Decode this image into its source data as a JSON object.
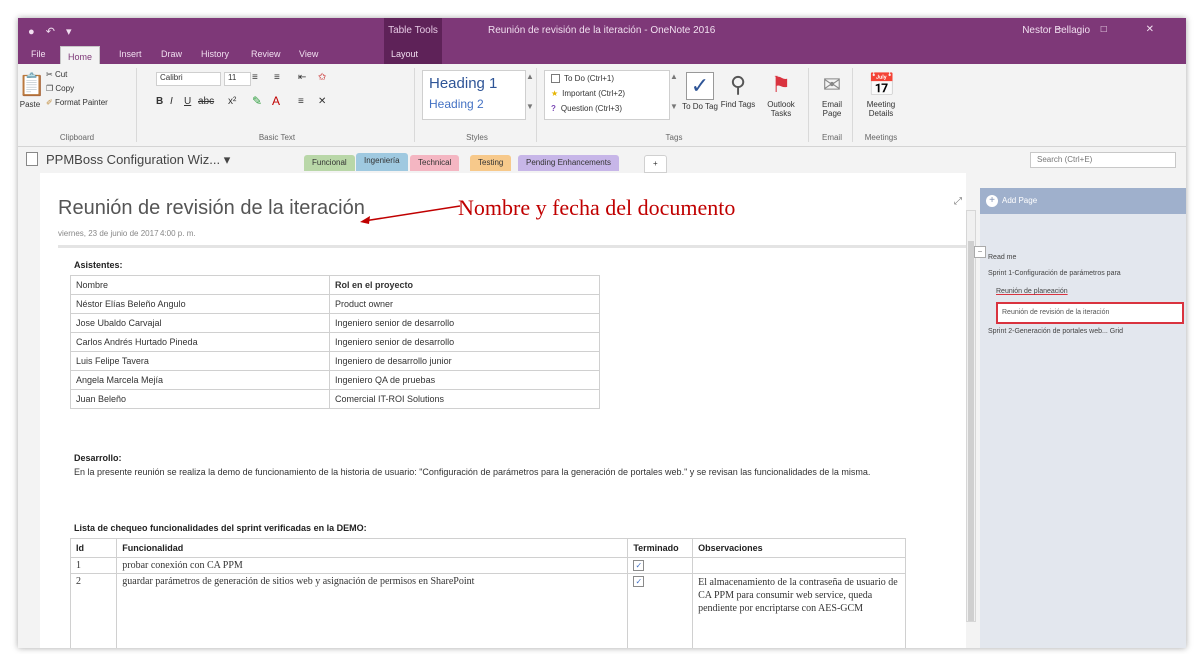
{
  "titlebar": {
    "quick_access": "● ↶ ▾",
    "contextual_tab": "Table Tools",
    "document_title": "Reunión de revisión de la iteración - OneNote 2016",
    "user": "Nestor Bellagio",
    "window_buttons": "− □ ✕"
  },
  "ribbon_tabs": [
    "File",
    "Home",
    "Insert",
    "Draw",
    "History",
    "Review",
    "View",
    "Layout"
  ],
  "ribbon": {
    "clipboard": {
      "paste": "Paste",
      "cut": "Cut",
      "copy": "Copy",
      "format_painter": "Format Painter",
      "label": "Clipboard"
    },
    "basic_text": {
      "font": "Calibri",
      "size": "11",
      "label": "Basic Text"
    },
    "styles": {
      "heading1": "Heading 1",
      "heading2": "Heading 2",
      "label": "Styles"
    },
    "tags": {
      "todo": "To Do (Ctrl+1)",
      "important": "Important (Ctrl+2)",
      "question": "Question (Ctrl+3)",
      "todo_tag": "To Do Tag",
      "find_tags": "Find Tags",
      "outlook_tasks": "Outlook Tasks",
      "label": "Tags"
    },
    "email": {
      "email_page": "Email Page",
      "label": "Email"
    },
    "meetings": {
      "meeting_details": "Meeting Details",
      "label": "Meetings"
    }
  },
  "notebook": {
    "name": "PPMBoss Configuration Wiz...",
    "dropdown": "▾",
    "sections": [
      {
        "label": "Funcional",
        "color": "#b9d7a8"
      },
      {
        "label": "Ingeniería",
        "color": "#9fc9e0"
      },
      {
        "label": "Technical",
        "color": "#f4b6c2"
      },
      {
        "label": "Testing",
        "color": "#f7c98b"
      },
      {
        "label": "Pending Enhancements",
        "color": "#c7b6e8"
      }
    ],
    "add_section": "+",
    "search_placeholder": "Search (Ctrl+E)"
  },
  "page": {
    "title": "Reunión de revisión de la iteración",
    "annotation": "Nombre y fecha del documento",
    "date": "viernes, 23 de junio de 2017",
    "time": "4:00 p. m.",
    "attendees_label": "Asistentes:",
    "attendees_headers": [
      "Nombre",
      "Rol en el proyecto"
    ],
    "attendees": [
      [
        "Néstor Elías Beleño Angulo",
        "Product owner"
      ],
      [
        "Jose Ubaldo Carvajal",
        "Ingeniero senior de desarrollo"
      ],
      [
        "Carlos Andrés Hurtado Pineda",
        "Ingeniero senior de desarrollo"
      ],
      [
        "Luis Felipe Tavera",
        "Ingeniero de desarrollo junior"
      ],
      [
        "Angela Marcela Mejía",
        "Ingeniero QA de pruebas"
      ],
      [
        "Juan Beleño",
        "Comercial IT-ROI Solutions"
      ]
    ],
    "development_label": "Desarrollo:",
    "development_text": "En la presente reunión se realiza la demo de funcionamiento de la historia de usuario: \"Configuración de parámetros para la generación de portales web.\" y se revisan las funcionalidades de la misma.",
    "checklist_label": "Lista de chequeo funcionalidades del sprint verificadas en la DEMO:",
    "checklist_headers": [
      "Id",
      "Funcionalidad",
      "Terminado",
      "Observaciones"
    ],
    "checklist": [
      {
        "id": "1",
        "func": "probar conexión con CA PPM",
        "done": "✓",
        "obs": ""
      },
      {
        "id": "2",
        "func": "guardar parámetros de generación de sitios web y asignación de permisos en SharePoint",
        "done": "✓",
        "obs": "El almacenamiento de la contraseña de usuario de CA PPM para consumir web service, queda pendiente por encriptarse con AES-GCM"
      }
    ]
  },
  "pages_pane": {
    "add_page": "Add Page",
    "items": [
      "Read me",
      "Sprint 1-Configuración de parámetros para",
      "Reunión de planeación",
      "Reunión de revisión de la iteración",
      "Sprint 2-Generación de portales web... Grid"
    ]
  }
}
